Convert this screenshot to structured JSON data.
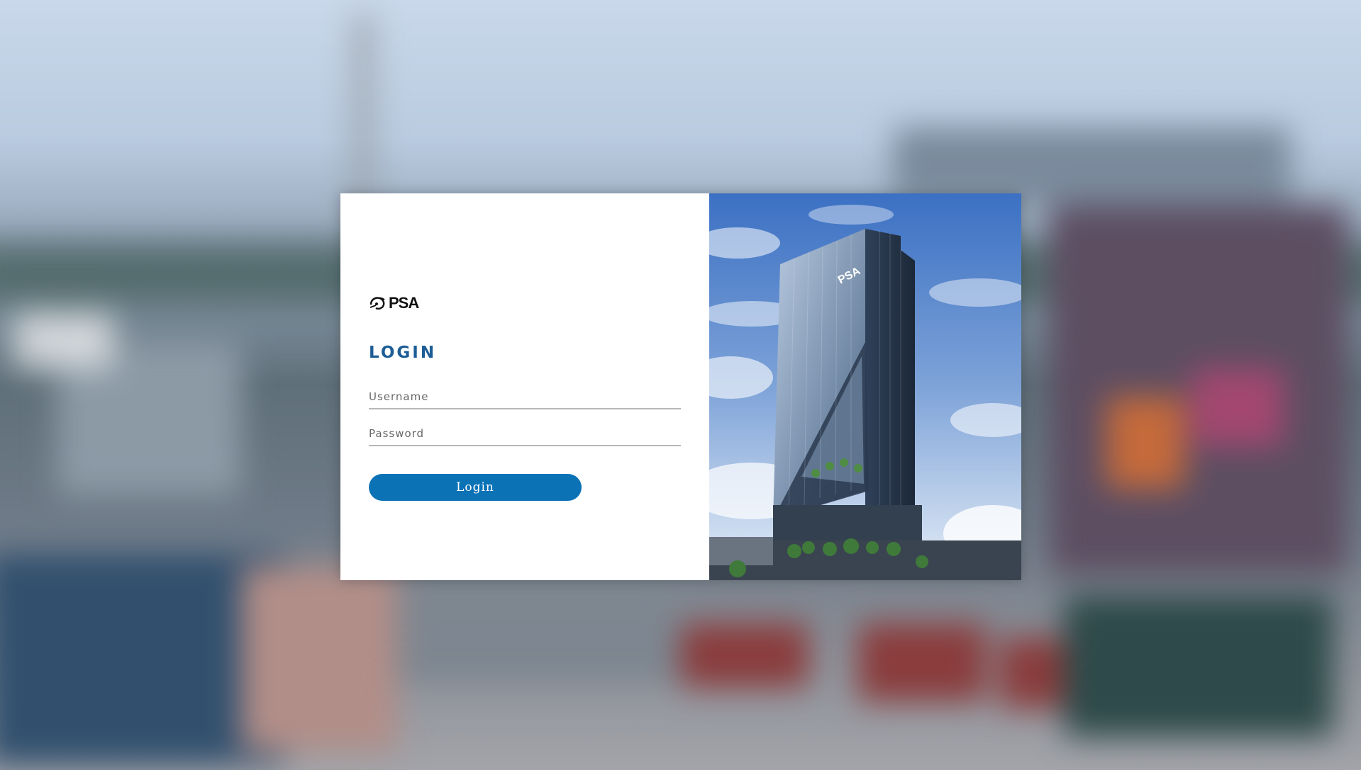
{
  "app": {
    "logo_text": "PSA"
  },
  "login": {
    "title": "LOGIN",
    "username_placeholder": "Username",
    "password_placeholder": "Password",
    "submit_label": "Login"
  },
  "colors": {
    "accent": "#1d5d96",
    "button": "#0b72b6",
    "card": "#ffffff"
  },
  "photo": {
    "building_signage": "PSA"
  }
}
